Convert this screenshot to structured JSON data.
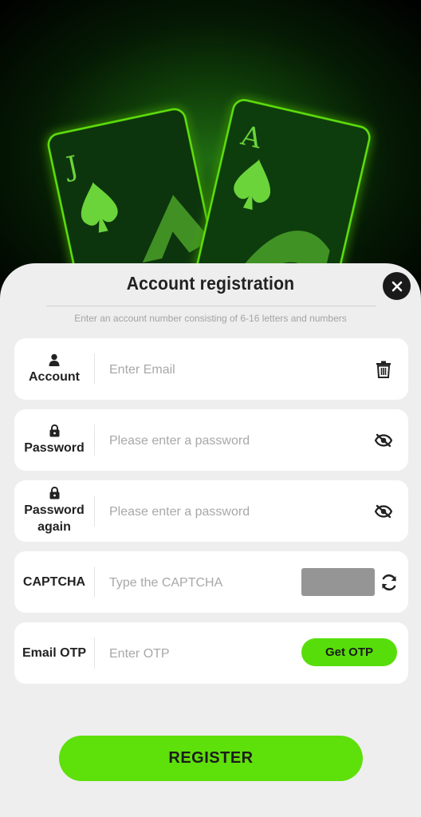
{
  "background": {
    "cards": [
      "J",
      "A"
    ],
    "accent": "#5fe00b"
  },
  "title": "Account registration",
  "hint": "Enter an account number consisting of 6-16 letters and numbers",
  "rows": [
    {
      "label": "Account",
      "icon": "user-icon",
      "placeholder": "Enter Email",
      "action_icon": "trash-icon"
    },
    {
      "label": "Password",
      "icon": "lock-icon",
      "placeholder": "Please enter a password",
      "action_icon": "eye-slash-icon"
    },
    {
      "label": "Password again",
      "icon": "lock-icon",
      "placeholder": "Please enter a password",
      "action_icon": "eye-slash-icon"
    },
    {
      "label": "CAPTCHA",
      "placeholder": "Type the CAPTCHA",
      "action_icon": "refresh-icon"
    },
    {
      "label": "Email OTP",
      "placeholder": "Enter OTP",
      "button": "Get OTP"
    }
  ],
  "register_label": "REGISTER",
  "colors": {
    "accent": "#5ee00b",
    "sheet": "#eeeeef",
    "card": "#ffffff"
  }
}
